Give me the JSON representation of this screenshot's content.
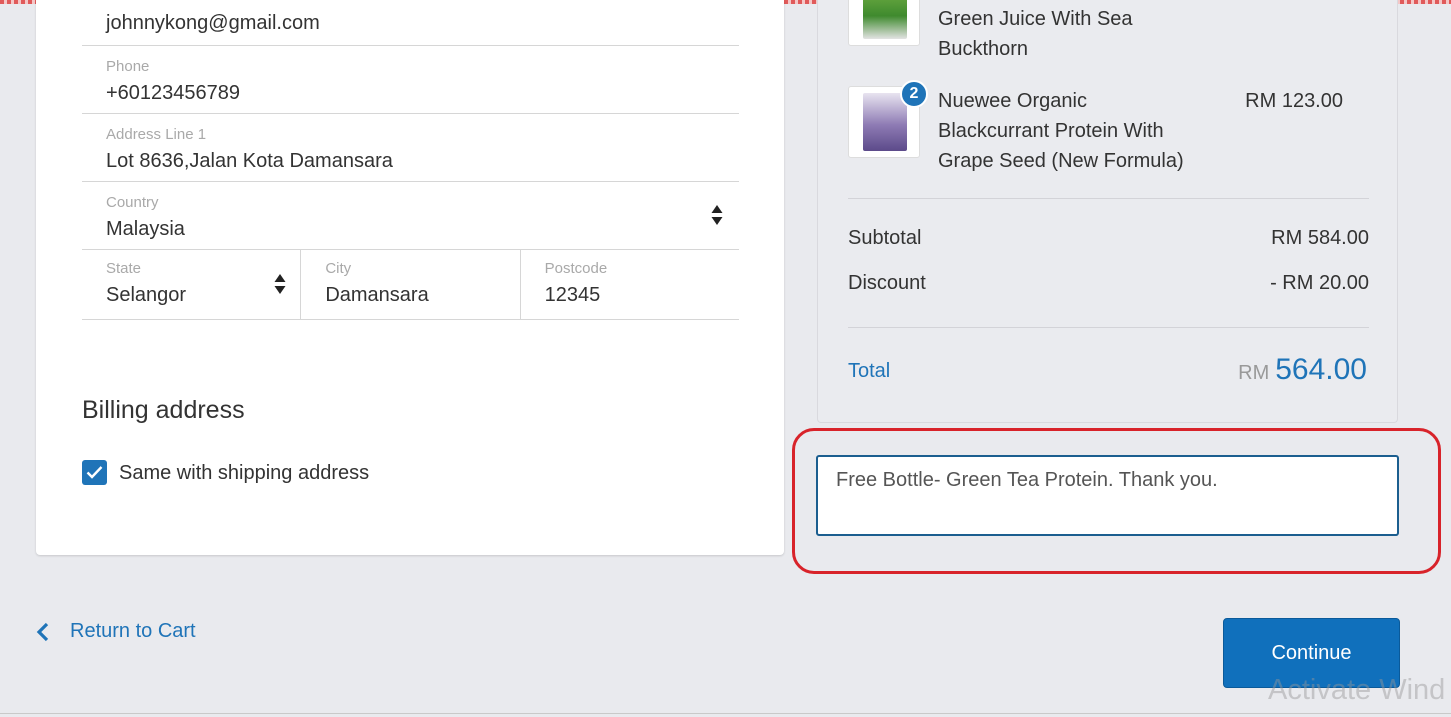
{
  "shipping": {
    "email_value": "johnnykong@gmail.com",
    "phone_label": "Phone",
    "phone_value": "+60123456789",
    "address_label": "Address Line 1",
    "address_value": "Lot 8636,Jalan Kota Damansara",
    "country_label": "Country",
    "country_value": "Malaysia",
    "state_label": "State",
    "state_value": "Selangor",
    "city_label": "City",
    "city_value": "Damansara",
    "postcode_label": "Postcode",
    "postcode_value": "12345"
  },
  "billing": {
    "title": "Billing address",
    "same_label": "Same with shipping address",
    "same_checked": true
  },
  "order": {
    "items": [
      {
        "name": "Green Juice With Sea Buckthorn",
        "name_lines": [
          "Green Juice With Sea",
          "Buckthorn"
        ],
        "price": ""
      },
      {
        "name": "Nuewee Organic Blackcurrant Protein With Grape Seed (New Formula)",
        "name_lines": [
          "Nuewee Organic",
          "Blackcurrant Protein With",
          "Grape Seed (New Formula)"
        ],
        "price": "RM 123.00",
        "quantity": "2"
      }
    ],
    "subtotal_label": "Subtotal",
    "subtotal_value": "RM 584.00",
    "discount_label": "Discount",
    "discount_value": "- RM 20.00",
    "total_label": "Total",
    "total_currency": "RM",
    "total_value": "564.00"
  },
  "note": {
    "value": "Free Bottle- Green Tea Protein. Thank you."
  },
  "nav": {
    "return_label": "Return to Cart",
    "continue_label": "Continue"
  },
  "watermark": "Activate Wind",
  "colors": {
    "accent": "#1f74b8",
    "highlight": "#d8232a",
    "background": "#e9eaee"
  },
  "icons": {
    "back": "chevron-left-icon",
    "select": "sort-arrows-icon",
    "check": "checkmark-icon",
    "scroll": "scroll-down-icon"
  }
}
